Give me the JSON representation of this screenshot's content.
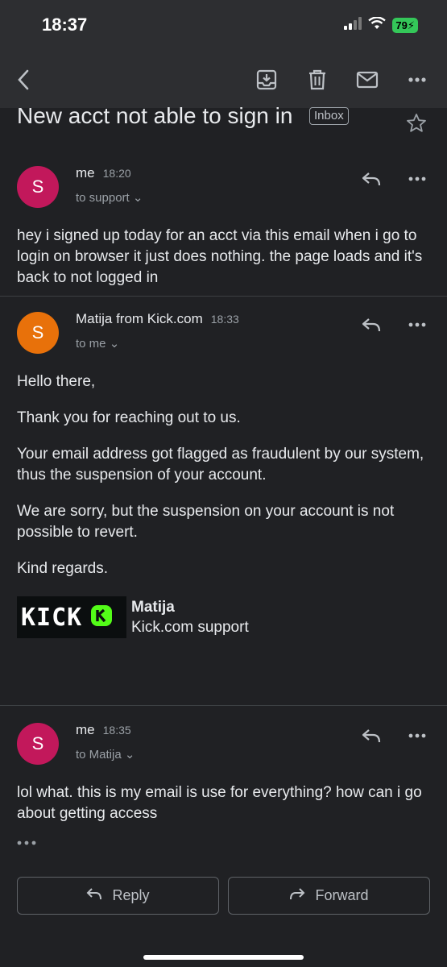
{
  "status_bar": {
    "time": "18:37",
    "battery": "79"
  },
  "toolbar": {
    "back_icon": "chevron-left-icon",
    "archive_icon": "archive-icon",
    "delete_icon": "trash-icon",
    "mark_unread_icon": "mail-icon",
    "more_icon": "more-horizontal-icon"
  },
  "subject": {
    "title": "New acct not able to sign in",
    "label": "Inbox"
  },
  "messages": [
    {
      "avatar_letter": "S",
      "avatar_color": "#c2185b",
      "sender": "me",
      "time": "18:20",
      "recipient": "to support",
      "body": [
        "hey i signed up today for an acct via this email when i go to login on browser it just does nothing. the page loads and it's back to not logged in"
      ]
    },
    {
      "avatar_letter": "S",
      "avatar_color": "#e8710a",
      "sender": "Matija from Kick.com",
      "time": "18:33",
      "recipient": "to me",
      "body": [
        "Hello there,",
        "Thank you for reaching out to us.",
        "Your email address got flagged as fraudulent by our system, thus the suspension of your account.",
        "We are sorry, but the suspension on your account is not possible to revert.",
        "Kind regards."
      ],
      "signature": {
        "logo_text": "KICK",
        "logo_color": "#53fc18",
        "name": "Matija",
        "team": "Kick.com support"
      }
    },
    {
      "avatar_letter": "S",
      "avatar_color": "#c2185b",
      "sender": "me",
      "time": "18:35",
      "recipient": "to Matija",
      "body": [
        "lol what. this is my email is use for everything? how can i go about getting access"
      ]
    }
  ],
  "actions": {
    "reply_label": "Reply",
    "forward_label": "Forward"
  }
}
